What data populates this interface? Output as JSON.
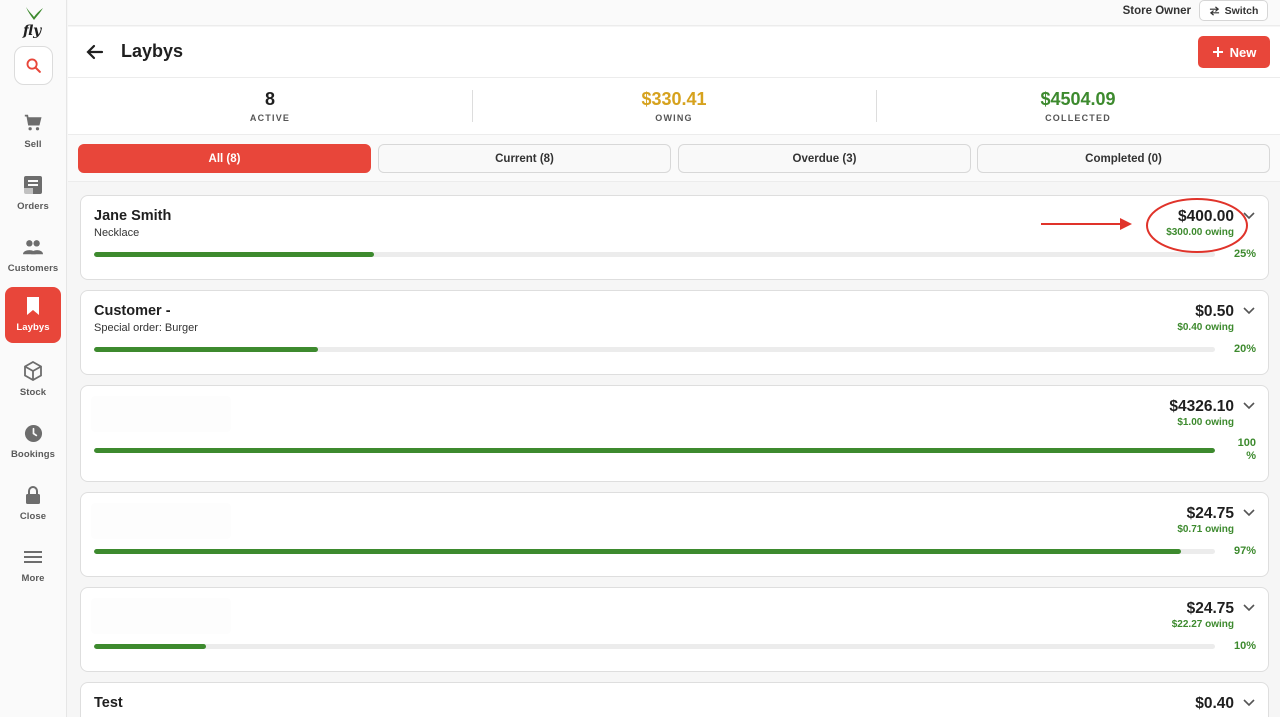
{
  "brand": {
    "accent": "#e8463a",
    "success": "#3d8a2e",
    "logo_text": "fly"
  },
  "topbar": {
    "user_role": "Store Owner",
    "switch_label": "Switch"
  },
  "header": {
    "title": "Laybys",
    "new_label": "New"
  },
  "stats": [
    {
      "value": "8",
      "label": "ACTIVE",
      "color": "#1f1f1f"
    },
    {
      "value": "$330.41",
      "label": "OWING",
      "color": "#d6a21e"
    },
    {
      "value": "$4504.09",
      "label": "COLLECTED",
      "color": "#3d8a2e"
    }
  ],
  "filters": [
    {
      "label": "All (8)",
      "active": true
    },
    {
      "label": "Current (8)",
      "active": false
    },
    {
      "label": "Overdue (3)",
      "active": false
    },
    {
      "label": "Completed (0)",
      "active": false
    }
  ],
  "sidebar": {
    "items": [
      {
        "label": "Sell",
        "icon": "cart-icon"
      },
      {
        "label": "Orders",
        "icon": "receipt-icon"
      },
      {
        "label": "Customers",
        "icon": "users-icon"
      },
      {
        "label": "Laybys",
        "icon": "bookmark-icon",
        "active": true
      },
      {
        "label": "Stock",
        "icon": "box-icon"
      },
      {
        "label": "Bookings",
        "icon": "clock-icon"
      },
      {
        "label": "Close",
        "icon": "lock-icon"
      },
      {
        "label": "More",
        "icon": "menu-icon"
      }
    ]
  },
  "laybys": [
    {
      "name": "Jane Smith",
      "subtitle": "Necklace",
      "amount": "$400.00",
      "owing": "$300.00 owing",
      "percent_label": "25%",
      "progress": 0.25
    },
    {
      "name": "Customer -",
      "subtitle": "Special order: Burger",
      "amount": "$0.50",
      "owing": "$0.40 owing",
      "percent_label": "20%",
      "progress": 0.2
    },
    {
      "name": "",
      "subtitle": "",
      "amount": "$4326.10",
      "owing": "$1.00 owing",
      "percent_label": "100 %",
      "progress": 1.0
    },
    {
      "name": "",
      "subtitle": "",
      "amount": "$24.75",
      "owing": "$0.71 owing",
      "percent_label": "97%",
      "progress": 0.97
    },
    {
      "name": "",
      "subtitle": "",
      "amount": "$24.75",
      "owing": "$22.27 owing",
      "percent_label": "10%",
      "progress": 0.1
    },
    {
      "name": "Test",
      "subtitle": "",
      "amount": "$0.40",
      "owing": "",
      "percent_label": "",
      "progress": 0
    }
  ]
}
